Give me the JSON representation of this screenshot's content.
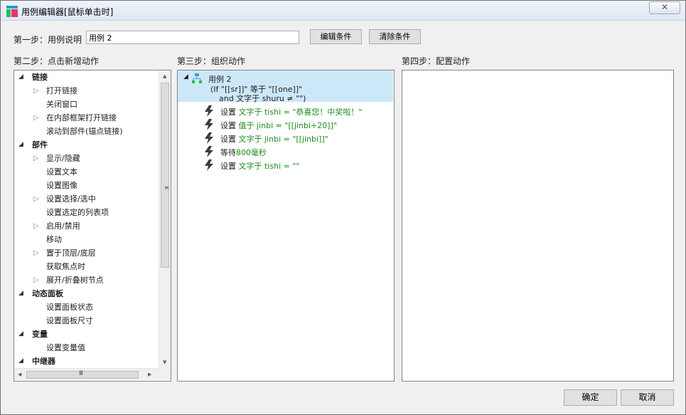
{
  "window": {
    "title": "用例编辑器[鼠标单击时]",
    "close_glyph": "✕"
  },
  "step1": {
    "label": "第一步：用例说明",
    "description_value": "用例 2",
    "edit_condition_label": "编辑条件",
    "clear_condition_label": "清除条件"
  },
  "step2": {
    "label": "第二步：点击新增动作",
    "tree": [
      {
        "label": "链接",
        "category": true,
        "expander": "◢"
      },
      {
        "label": "打开链接",
        "category": false,
        "expander": "▷"
      },
      {
        "label": "关闭窗口",
        "category": false,
        "expander": ""
      },
      {
        "label": "在内部框架打开链接",
        "category": false,
        "expander": "▷"
      },
      {
        "label": "滚动到部件(锚点链接)",
        "category": false,
        "expander": ""
      },
      {
        "label": "部件",
        "category": true,
        "expander": "◢"
      },
      {
        "label": "显示/隐藏",
        "category": false,
        "expander": "▷"
      },
      {
        "label": "设置文本",
        "category": false,
        "expander": ""
      },
      {
        "label": "设置图像",
        "category": false,
        "expander": ""
      },
      {
        "label": "设置选择/选中",
        "category": false,
        "expander": "▷"
      },
      {
        "label": "设置选定的列表项",
        "category": false,
        "expander": ""
      },
      {
        "label": "启用/禁用",
        "category": false,
        "expander": "▷"
      },
      {
        "label": "移动",
        "category": false,
        "expander": ""
      },
      {
        "label": "置于顶层/底层",
        "category": false,
        "expander": "▷"
      },
      {
        "label": "获取焦点时",
        "category": false,
        "expander": ""
      },
      {
        "label": "展开/折叠树节点",
        "category": false,
        "expander": "▷"
      },
      {
        "label": "动态面板",
        "category": true,
        "expander": "◢"
      },
      {
        "label": "设置面板状态",
        "category": false,
        "expander": ""
      },
      {
        "label": "设置面板尺寸",
        "category": false,
        "expander": ""
      },
      {
        "label": "变量",
        "category": true,
        "expander": "◢"
      },
      {
        "label": "设置变量值",
        "category": false,
        "expander": ""
      },
      {
        "label": "中继器",
        "category": true,
        "expander": "◢"
      }
    ]
  },
  "step3": {
    "label": "第三步：组织动作",
    "case": {
      "expander": "◢",
      "name": "用例 2",
      "condition_line1": "(If \"[[sr]]\" 等于 \"[[one]]\"",
      "condition_line2": "and 文字于 shuru ≠ \"\")"
    },
    "actions": [
      {
        "verb": "设置",
        "detail": "文字于 tishi = \"恭喜您！中奖啦！\""
      },
      {
        "verb": "设置",
        "detail": "值于 jinbi = \"[[jinbi+20]]\""
      },
      {
        "verb": "设置",
        "detail": "文字于 jinbi = \"[[jinbi]]\""
      },
      {
        "verb": "等待",
        "detail": "800毫秒"
      },
      {
        "verb": "设置",
        "detail": "文字于 tishi = \"\""
      }
    ]
  },
  "step4": {
    "label": "第四步：配置动作"
  },
  "footer": {
    "ok_label": "确定",
    "cancel_label": "取消"
  },
  "colors": {
    "selection": "#cce8f8",
    "action_detail": "#1a8c1a",
    "case_icon": "#3aa0d8"
  }
}
